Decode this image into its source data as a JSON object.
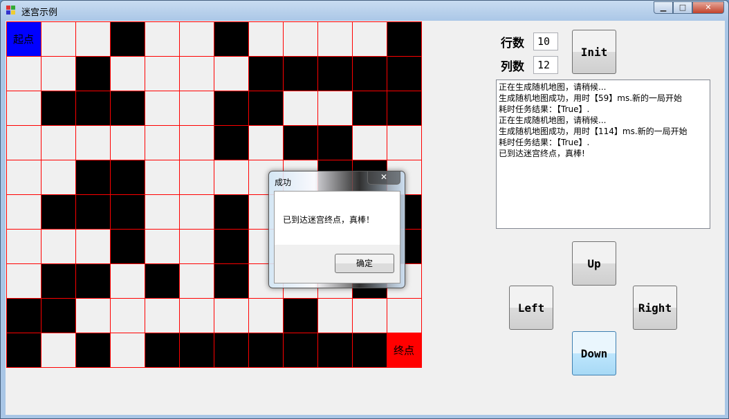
{
  "window": {
    "title": "迷宫示例",
    "minimize": "▁",
    "maximize": "□",
    "close": "✕"
  },
  "controls": {
    "rows_label": "行数",
    "rows_value": "10",
    "cols_label": "列数",
    "cols_value": "12",
    "init": "Init",
    "up": "Up",
    "left": "Left",
    "right": "Right",
    "down": "Down"
  },
  "maze": {
    "start_label": "起点",
    "end_label": "终点",
    "colors": {
      "wall": "#000000",
      "path": "#f0f0f0",
      "start": "#0000ff",
      "end": "#ff0000",
      "grid_line": "#ff0000"
    },
    "cells": [
      [
        2,
        0,
        0,
        1,
        0,
        0,
        1,
        0,
        0,
        0,
        0,
        1
      ],
      [
        0,
        0,
        1,
        0,
        0,
        0,
        0,
        1,
        1,
        1,
        1,
        1
      ],
      [
        0,
        1,
        1,
        1,
        0,
        0,
        1,
        1,
        0,
        0,
        1,
        1
      ],
      [
        0,
        0,
        0,
        0,
        0,
        0,
        1,
        0,
        1,
        1,
        0,
        0
      ],
      [
        0,
        0,
        1,
        1,
        0,
        0,
        0,
        0,
        0,
        1,
        1,
        0
      ],
      [
        0,
        1,
        1,
        1,
        0,
        0,
        1,
        0,
        0,
        0,
        0,
        1
      ],
      [
        0,
        0,
        0,
        1,
        0,
        0,
        1,
        0,
        0,
        0,
        0,
        1
      ],
      [
        0,
        1,
        1,
        0,
        1,
        0,
        1,
        0,
        0,
        0,
        1,
        0
      ],
      [
        1,
        1,
        0,
        0,
        0,
        0,
        0,
        0,
        1,
        0,
        0,
        0
      ],
      [
        1,
        0,
        1,
        0,
        1,
        1,
        1,
        1,
        1,
        1,
        1,
        3
      ]
    ]
  },
  "log": [
    "正在生成随机地图，请稍候...",
    "生成随机地图成功，用时【59】ms.新的一局开始",
    "耗时任务结果：【True】.",
    "正在生成随机地图，请稍候...",
    "生成随机地图成功，用时【114】ms.新的一局开始",
    "耗时任务结果：【True】.",
    "已到达迷宫终点，真棒!"
  ],
  "dialog": {
    "title": "成功",
    "message": "已到达迷宫终点，真棒！",
    "ok": "确定",
    "close": "✕"
  }
}
